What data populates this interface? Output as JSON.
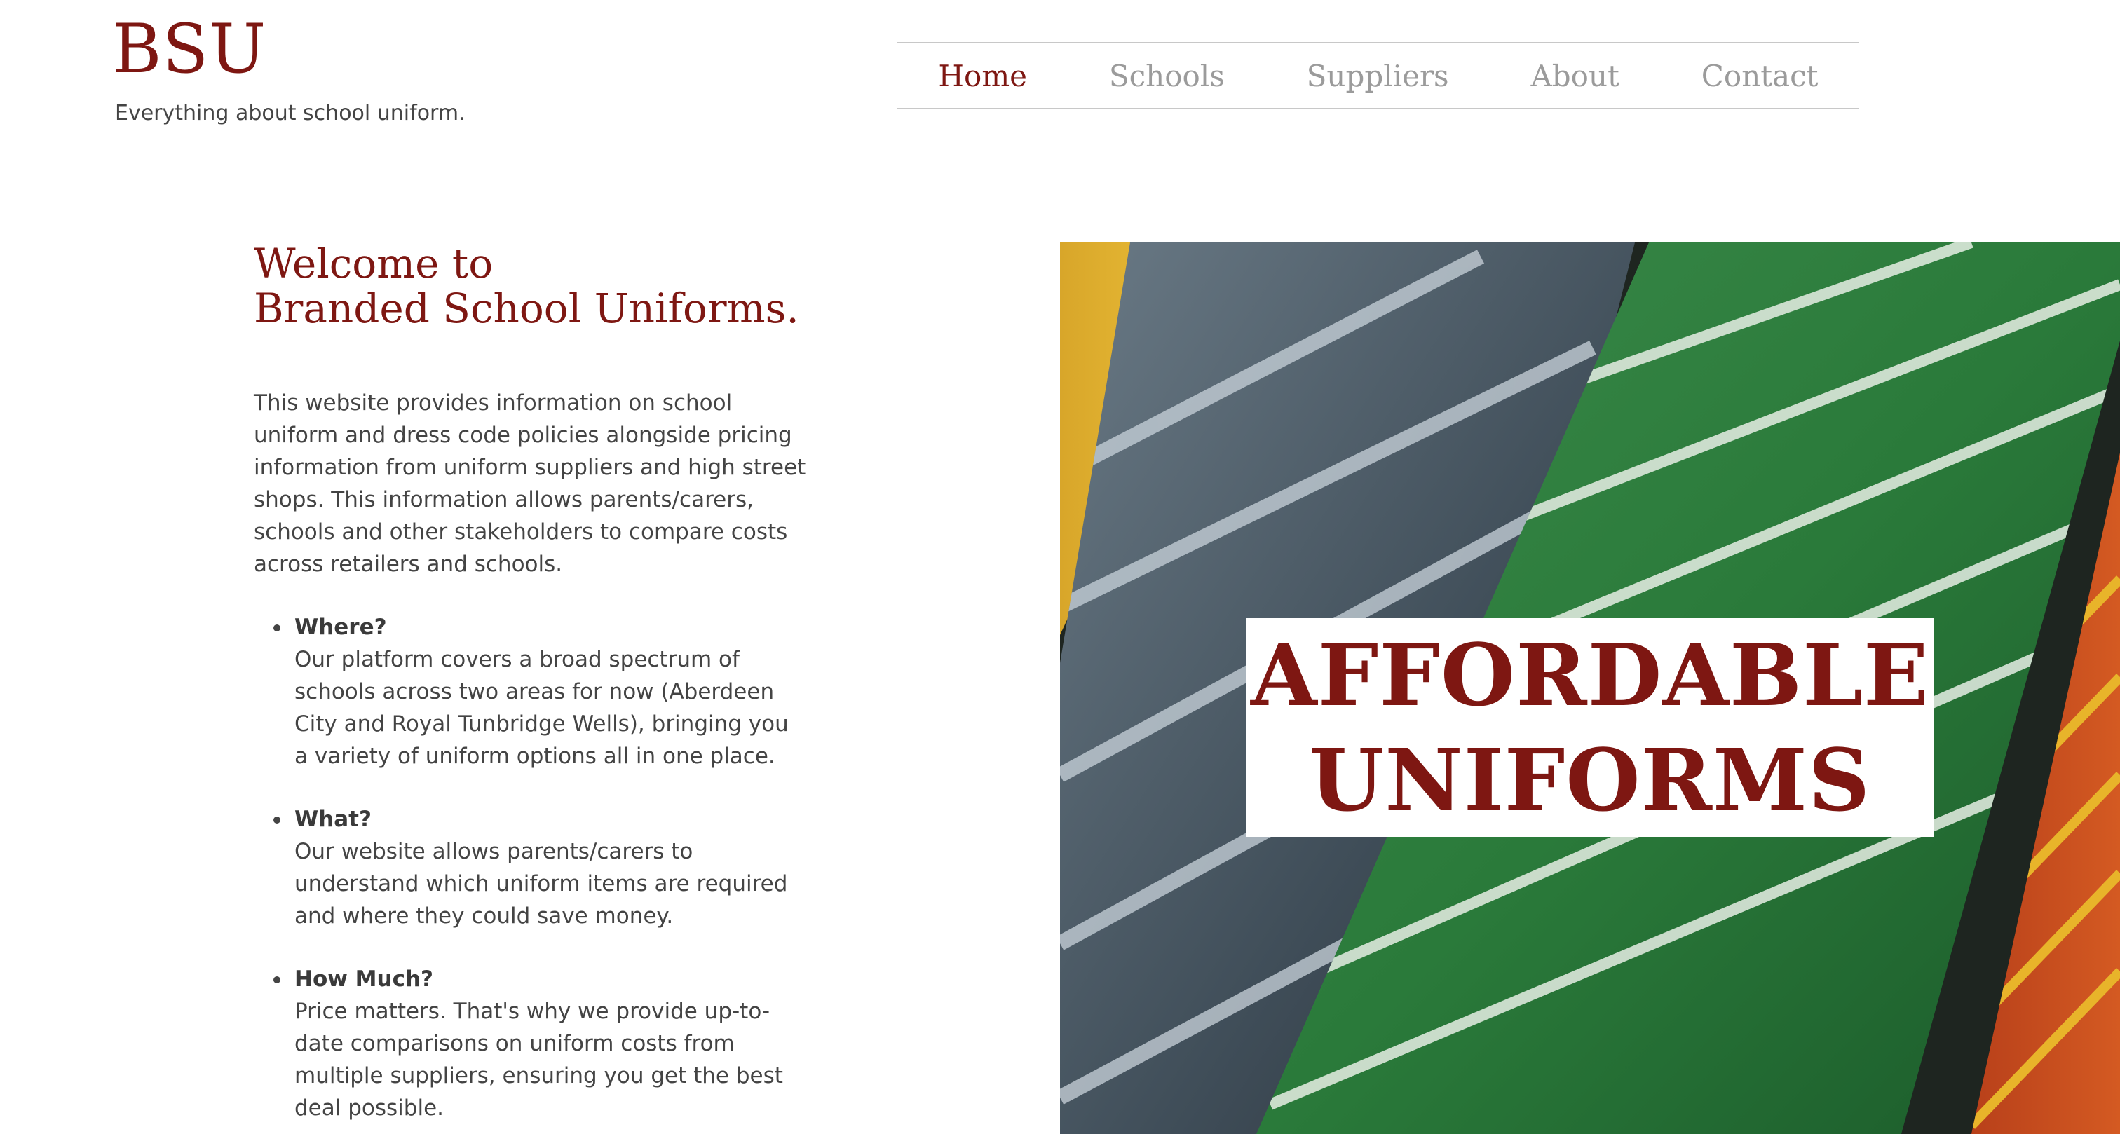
{
  "header": {
    "logo": "BSU",
    "tagline": "Everything about school uniform."
  },
  "nav": {
    "items": [
      {
        "label": "Home",
        "active": true
      },
      {
        "label": "Schools",
        "active": false
      },
      {
        "label": "Suppliers",
        "active": false
      },
      {
        "label": "About",
        "active": false
      },
      {
        "label": "Contact",
        "active": false
      }
    ]
  },
  "intro": {
    "title_line1": "Welcome to",
    "title_line2": "Branded School Uniforms.",
    "body": "This website provides information on school uniform and dress code policies alongside pricing information from uniform suppliers and high street shops. This information allows parents/carers, schools and other stakeholders to compare costs across retailers and schools.",
    "points": [
      {
        "title": "Where?",
        "text": "Our platform covers a broad spectrum of schools across two areas for now (Aberdeen City and Royal Tunbridge Wells), bringing you a variety of uniform options all in one place."
      },
      {
        "title": "What?",
        "text": "Our website allows parents/carers to understand which uniform items are required and where they could save money."
      },
      {
        "title": "How Much?",
        "text": "Price matters. That's why we provide up-to-date comparisons on uniform costs from multiple suppliers, ensuring you get the best deal possible."
      }
    ]
  },
  "hero": {
    "overlay_line1": "AFFORDABLE",
    "overlay_line2": "UNIFORMS"
  },
  "colors": {
    "brand": "#7e1712",
    "nav_inactive": "#9b9b9b",
    "text": "#444444"
  }
}
